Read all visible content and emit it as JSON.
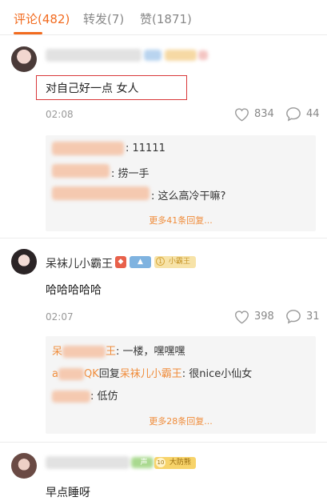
{
  "tabs": [
    {
      "label": "评论(482)",
      "active": true
    },
    {
      "label": "转发(7)",
      "active": false
    },
    {
      "label": "赞(1871)",
      "active": false
    }
  ],
  "comments": [
    {
      "content": "对自己好一点 女人",
      "time": "02:08",
      "likes": "834",
      "replies_count": "44",
      "replies": [
        {
          "text": ": 11111"
        },
        {
          "text": ": 捞一手"
        },
        {
          "text": ": 这么高冷干嘛?"
        }
      ],
      "more": "更多41条回复..."
    },
    {
      "username": "呆袜儿小霸王",
      "badge_level": "1",
      "badge_label": "小霸王",
      "content": "哈哈哈哈哈",
      "time": "02:07",
      "likes": "398",
      "replies_count": "31",
      "replies": [
        {
          "nick": "呆",
          "nick2": "王",
          "text": ": 一楼，嘿嘿嘿"
        },
        {
          "nick": "a",
          "nick2": "QK",
          "mid": "回复",
          "target": "呆袜儿小霸王",
          "text": ": 很nice小仙女"
        },
        {
          "text": ": 低仿"
        }
      ],
      "more": "更多28条回复..."
    },
    {
      "badge_level": "10",
      "badge_label": "大防熊",
      "badge_sound": "声",
      "content": "早点睡呀"
    }
  ],
  "colors": {
    "accent": "#f26b1f",
    "nick": "#f08c3a",
    "highlight": "#d9383a"
  }
}
